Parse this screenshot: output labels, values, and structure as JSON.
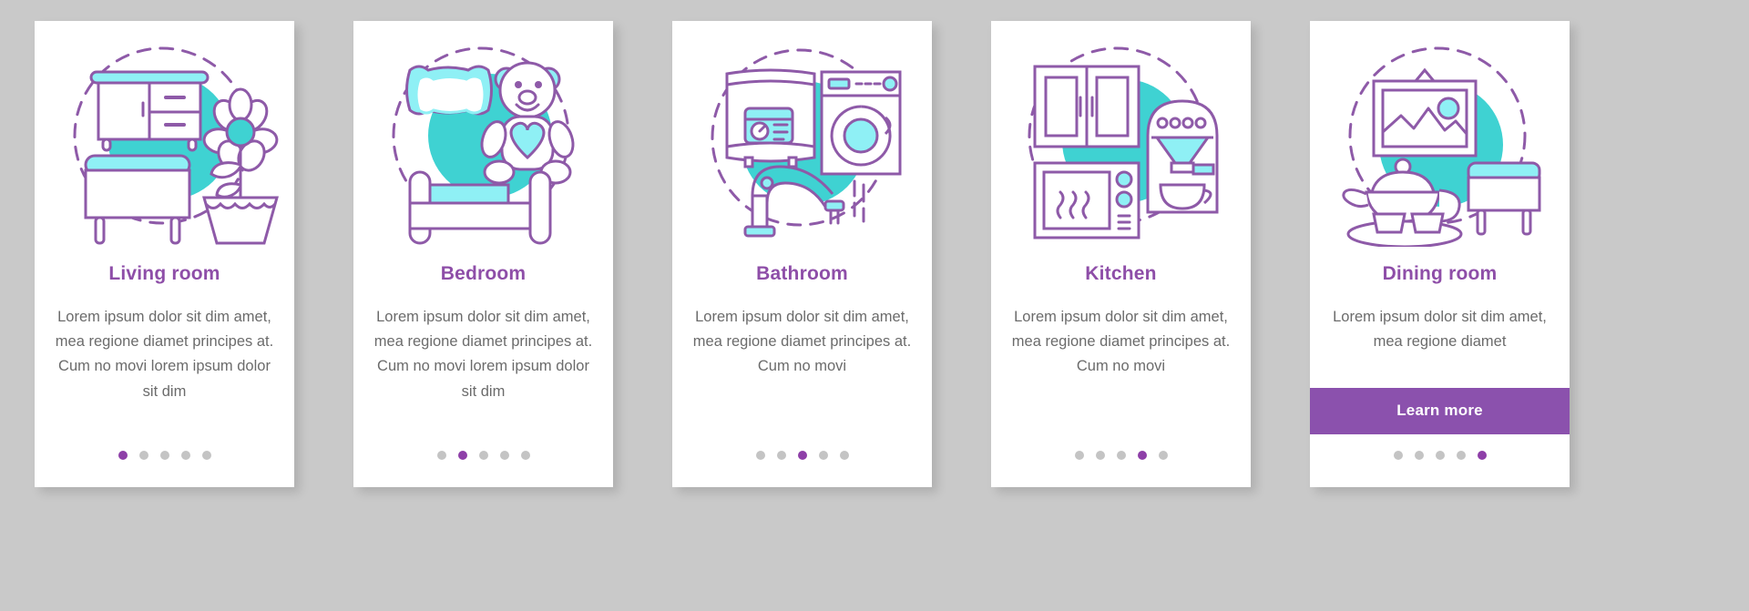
{
  "page": {
    "background_color": "#c9c9c9",
    "card_background": "#ffffff",
    "accent_color": "#8e4ea8",
    "button_color": "#8b51ad",
    "teal_color": "#3fd2d2",
    "light_teal_color": "#8ff0f5",
    "outline_color": "#8e5aa8",
    "dot_inactive_color": "#c4c4c4",
    "body_text_color": "#6b6b6b",
    "dots_total": 5
  },
  "cards": [
    {
      "id": "living-room",
      "title": "Living room",
      "body": "Lorem ipsum dolor sit dim amet, mea regione diamet principes at. Cum no movi lorem ipsum dolor sit dim",
      "illustration": "living-room-illustration",
      "active_dot": 1,
      "has_button": false,
      "button_label": ""
    },
    {
      "id": "bedroom",
      "title": "Bedroom",
      "body": "Lorem ipsum dolor sit dim amet, mea regione diamet principes at. Cum no movi lorem ipsum dolor sit dim",
      "illustration": "bedroom-illustration",
      "active_dot": 2,
      "has_button": false,
      "button_label": ""
    },
    {
      "id": "bathroom",
      "title": "Bathroom",
      "body": "Lorem ipsum dolor sit dim amet, mea regione diamet principes at. Cum no movi",
      "illustration": "bathroom-illustration",
      "active_dot": 3,
      "has_button": false,
      "button_label": ""
    },
    {
      "id": "kitchen",
      "title": "Kitchen",
      "body": "Lorem ipsum dolor sit dim amet, mea regione diamet principes at. Cum no movi",
      "illustration": "kitchen-illustration",
      "active_dot": 4,
      "has_button": false,
      "button_label": ""
    },
    {
      "id": "dining-room",
      "title": "Dining room",
      "body": "Lorem ipsum dolor sit dim amet, mea regione diamet",
      "illustration": "dining-room-illustration",
      "active_dot": 5,
      "has_button": true,
      "button_label": "Learn more"
    }
  ]
}
